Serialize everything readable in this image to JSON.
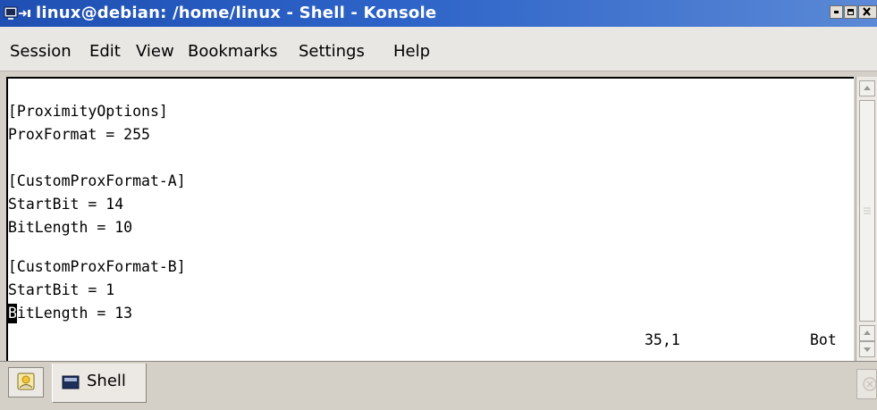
{
  "window": {
    "title": "linux@debian: /home/linux - Shell - Konsole"
  },
  "menubar": {
    "items": [
      "Session",
      "Edit",
      "View",
      "Bookmarks",
      "Settings",
      "Help"
    ]
  },
  "terminal": {
    "lines": [
      "[ProximityOptions]",
      "ProxFormat = 255",
      "",
      "[CustomProxFormat-A]",
      "StartBit = 14",
      "BitLength = 10",
      "",
      "[CustomProxFormat-B]",
      "StartBit = 1"
    ],
    "cursor_line": {
      "cursor_char": "B",
      "rest": "itLength = 13"
    },
    "status_position": "35,1",
    "status_scroll": "Bot"
  },
  "tabs": [
    {
      "label": "Shell",
      "active": true
    }
  ],
  "icons": {
    "window_app": "konsole-terminal-icon",
    "new_session": "new-session-icon",
    "tab": "shell-terminal-icon",
    "close_tab": "close-session-icon"
  },
  "colors": {
    "titlebar_start": "#1f4fb2",
    "titlebar_end": "#5b89d6",
    "terminal_bg": "#ffffff",
    "terminal_fg": "#000000"
  }
}
